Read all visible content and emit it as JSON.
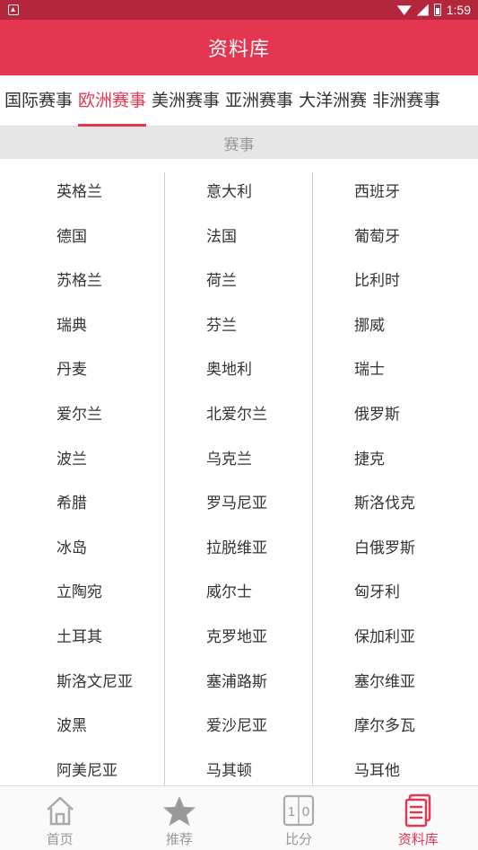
{
  "status_bar": {
    "time": "1:59"
  },
  "app_bar": {
    "title": "资料库"
  },
  "tabs": [
    {
      "label": "国际赛事",
      "active": false
    },
    {
      "label": "欧洲赛事",
      "active": true
    },
    {
      "label": "美洲赛事",
      "active": false
    },
    {
      "label": "亚洲赛事",
      "active": false
    },
    {
      "label": "大洋洲赛",
      "active": false
    },
    {
      "label": "非洲赛事",
      "active": false
    }
  ],
  "section": {
    "label": "赛事"
  },
  "countries": [
    [
      "英格兰",
      "意大利",
      "西班牙"
    ],
    [
      "德国",
      "法国",
      "葡萄牙"
    ],
    [
      "苏格兰",
      "荷兰",
      "比利时"
    ],
    [
      "瑞典",
      "芬兰",
      "挪威"
    ],
    [
      "丹麦",
      "奥地利",
      "瑞士"
    ],
    [
      "爱尔兰",
      "北爱尔兰",
      "俄罗斯"
    ],
    [
      "波兰",
      "乌克兰",
      "捷克"
    ],
    [
      "希腊",
      "罗马尼亚",
      "斯洛伐克"
    ],
    [
      "冰岛",
      "拉脱维亚",
      "白俄罗斯"
    ],
    [
      "立陶宛",
      "威尔士",
      "匈牙利"
    ],
    [
      "土耳其",
      "克罗地亚",
      "保加利亚"
    ],
    [
      "斯洛文尼亚",
      "塞浦路斯",
      "塞尔维亚"
    ],
    [
      "波黑",
      "爱沙尼亚",
      "摩尔多瓦"
    ],
    [
      "阿美尼亚",
      "马其顿",
      "马耳他"
    ]
  ],
  "bottom_nav": [
    {
      "label": "首页",
      "icon": "home-icon",
      "active": false
    },
    {
      "label": "推荐",
      "icon": "star-icon",
      "active": false
    },
    {
      "label": "比分",
      "icon": "scoreboard-icon",
      "active": false,
      "icon_text": "1|0"
    },
    {
      "label": "资料库",
      "icon": "document-icon",
      "active": true
    }
  ],
  "colors": {
    "accent": "#e43650",
    "status_bar": "#b3263c",
    "inactive": "#999999"
  }
}
